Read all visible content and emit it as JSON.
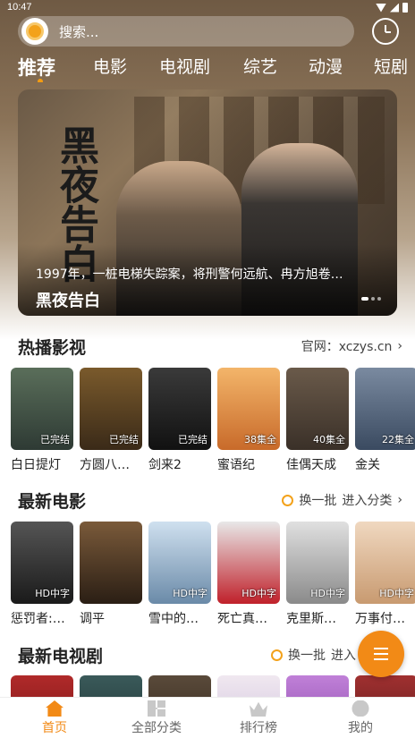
{
  "status_bar": {
    "time": "10:47"
  },
  "search": {
    "placeholder": "搜索..."
  },
  "categories": [
    "推荐",
    "电影",
    "电视剧",
    "综艺",
    "动漫",
    "短剧"
  ],
  "banner": {
    "art_title": "黑夜告白",
    "description": "1997年，一桩电梯失踪案，将刑警何远航、冉方旭卷…",
    "title": "黑夜告白"
  },
  "hot": {
    "title": "热播影视",
    "right_text": "官网：xczys.cn",
    "items": [
      {
        "name": "白日提灯",
        "badge": "已完结",
        "c1": "#5a6e5a",
        "c2": "#2e3a34"
      },
      {
        "name": "方圆八…",
        "badge": "已完结",
        "c1": "#7a5a2c",
        "c2": "#3a2a18"
      },
      {
        "name": "剑来2",
        "badge": "已完结",
        "c1": "#3a3a3a",
        "c2": "#111111"
      },
      {
        "name": "蜜语纪",
        "badge": "38集全",
        "c1": "#f3b56a",
        "c2": "#c86a2a"
      },
      {
        "name": "佳偶天成",
        "badge": "40集全",
        "c1": "#6a5a4a",
        "c2": "#3a3028"
      },
      {
        "name": "金关",
        "badge": "22集全",
        "c1": "#7a8aa0",
        "c2": "#3a4a60"
      }
    ]
  },
  "movies": {
    "title": "最新电影",
    "refresh_label": "换一批",
    "more_label": "进入分类",
    "items": [
      {
        "name": "惩罚者:…",
        "badge": "HD中字",
        "c1": "#555555",
        "c2": "#1a1a1a"
      },
      {
        "name": "调平",
        "badge": "",
        "c1": "#7a5a3a",
        "c2": "#2a1e14"
      },
      {
        "name": "雪中的…",
        "badge": "HD中字",
        "c1": "#cfe0ef",
        "c2": "#6a8aa8"
      },
      {
        "name": "死亡真…",
        "badge": "HD中字",
        "c1": "#e8e8e8",
        "c2": "#c0202a"
      },
      {
        "name": "克里斯…",
        "badge": "HD中字",
        "c1": "#e0e0e0",
        "c2": "#8a8a8a"
      },
      {
        "name": "万事付…",
        "badge": "HD中字",
        "c1": "#f0d8c0",
        "c2": "#c89a70"
      }
    ]
  },
  "tv": {
    "title": "最新电视剧",
    "refresh_label": "换一批",
    "more_label": "进入",
    "items": [
      {
        "c1": "#b02a2a",
        "c2": "#6a1010"
      },
      {
        "c1": "#3a5a5a",
        "c2": "#1a2a2a"
      },
      {
        "c1": "#5a4a3a",
        "c2": "#2a2018"
      },
      {
        "c1": "#f0e8f0",
        "c2": "#c8b8d8"
      },
      {
        "c1": "#c080d8",
        "c2": "#8040a0"
      },
      {
        "c1": "#a03030",
        "c2": "#501818"
      }
    ]
  },
  "tabbar": [
    "首页",
    "全部分类",
    "排行榜",
    "我的"
  ],
  "colors": {
    "accent": "#f28a16"
  }
}
